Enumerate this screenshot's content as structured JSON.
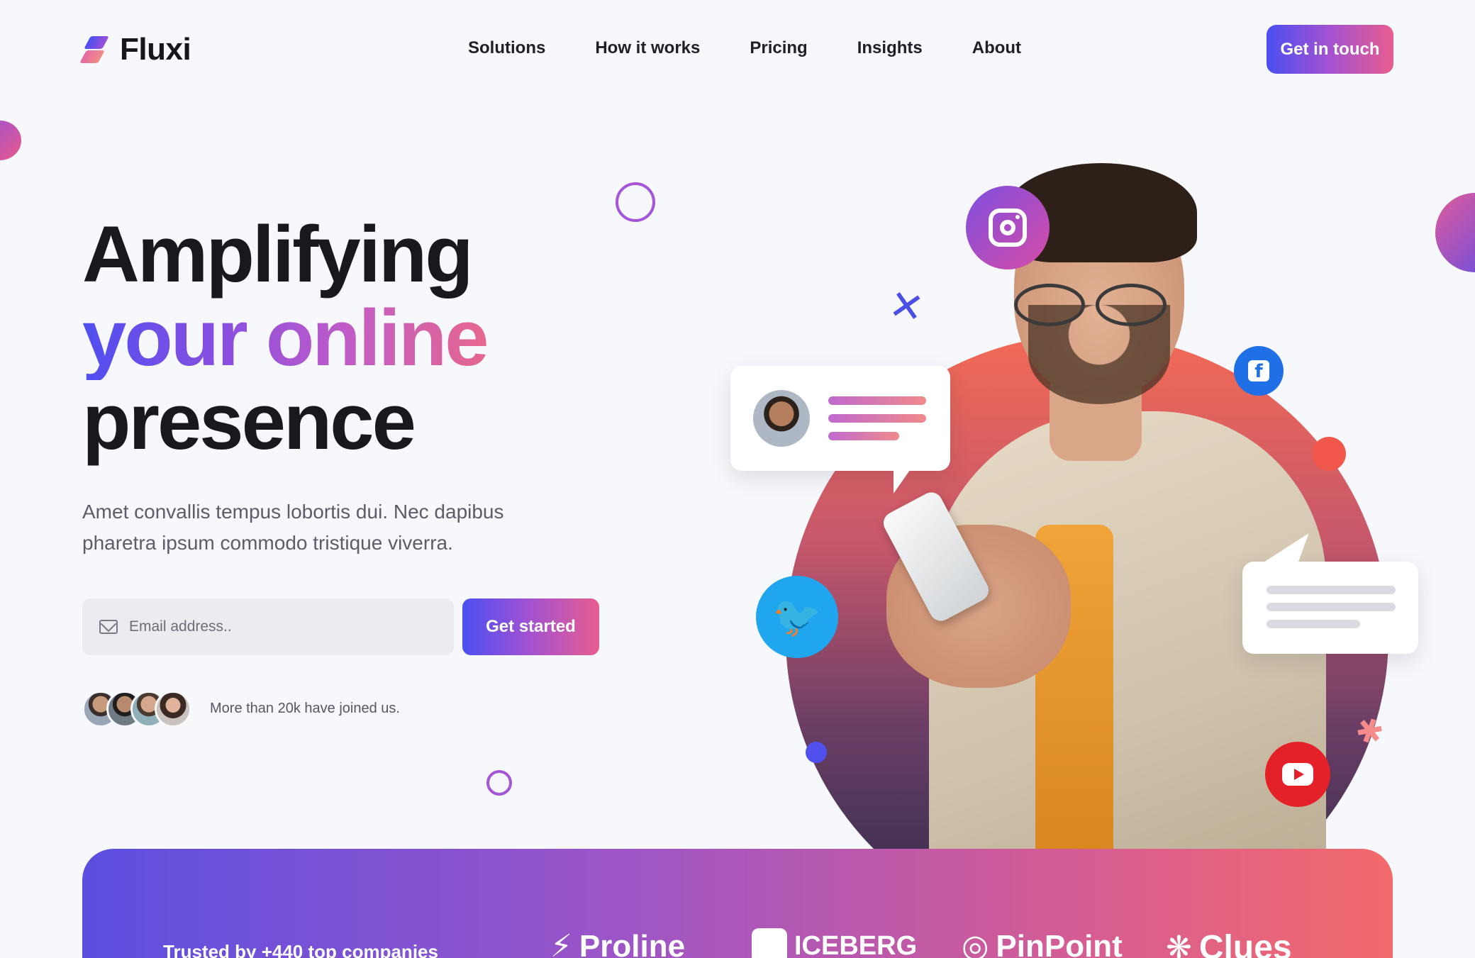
{
  "brand": {
    "name": "Fluxi"
  },
  "nav": {
    "items": [
      "Solutions",
      "How it works",
      "Pricing",
      "Insights",
      "About"
    ],
    "cta": "Get in touch"
  },
  "hero": {
    "headline_line1": "Amplifying",
    "headline_line2": "your online",
    "headline_line3": "presence",
    "subtext": "Amet convallis tempus lobortis dui. Nec dapibus pharetra ipsum commodo tristique viverra.",
    "email_placeholder": "Email address..",
    "cta": "Get started",
    "joined_text": "More than 20k have joined us."
  },
  "icons": {
    "social": [
      "instagram-icon",
      "facebook-icon",
      "twitter-icon",
      "youtube-icon"
    ]
  },
  "trusted": {
    "label": "Trusted by +440 top companies",
    "companies": [
      "Proline",
      "ICEBERG",
      "PinPoint",
      "Clues"
    ]
  },
  "colors": {
    "accent_start": "#4b4ff2",
    "accent_mid": "#a452d0",
    "accent_end": "#e85d8f",
    "background": "#f7f8fb"
  }
}
